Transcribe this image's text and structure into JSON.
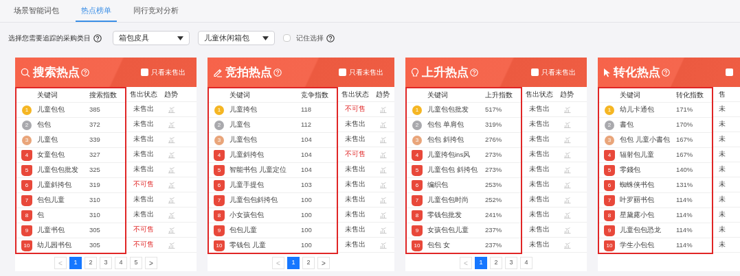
{
  "tabs": [
    {
      "label": "场景智能词包",
      "selected": false
    },
    {
      "label": "热点榜单",
      "selected": true
    },
    {
      "label": "同行竞对分析",
      "selected": false
    }
  ],
  "filter": {
    "label": "选择您需要追踪的采购类目",
    "category": "箱包皮具",
    "subcategory": "儿童休闲箱包",
    "remember": {
      "label": "记住选择",
      "checked": false
    }
  },
  "panels": [
    {
      "title": "搜索热点",
      "filter_checkbox": {
        "label": "只看未售出",
        "checked": false
      },
      "columns": [
        "关键词",
        "搜索指数",
        "售出状态",
        "趋势"
      ],
      "rows": [
        {
          "rank": "1",
          "keyword": "儿童包包",
          "index": "385",
          "status": "未售出",
          "kind": "unsold"
        },
        {
          "rank": "2",
          "keyword": "包包",
          "index": "372",
          "status": "未售出",
          "kind": "unsold"
        },
        {
          "rank": "3",
          "keyword": "儿童包",
          "index": "339",
          "status": "未售出",
          "kind": "unsold"
        },
        {
          "rank": "4",
          "keyword": "女童包包",
          "index": "327",
          "status": "未售出",
          "kind": "unsold"
        },
        {
          "rank": "5",
          "keyword": "儿童包包批发",
          "index": "325",
          "status": "未售出",
          "kind": "unsold"
        },
        {
          "rank": "6",
          "keyword": "儿童斜挎包",
          "index": "319",
          "status": "不可售",
          "kind": "unavailable"
        },
        {
          "rank": "7",
          "keyword": "包包儿童",
          "index": "310",
          "status": "未售出",
          "kind": "unsold"
        },
        {
          "rank": "8",
          "keyword": "包",
          "index": "310",
          "status": "未售出",
          "kind": "unsold"
        },
        {
          "rank": "9",
          "keyword": "儿童书包",
          "index": "305",
          "status": "不可售",
          "kind": "unavailable"
        },
        {
          "rank": "10",
          "keyword": "幼儿园书包",
          "index": "305",
          "status": "不可售",
          "kind": "unavailable"
        }
      ],
      "pagination": {
        "prev": "<",
        "next": ">",
        "pages": [
          {
            "label": "1",
            "selected": true
          },
          {
            "label": "2",
            "selected": false
          },
          {
            "label": "3",
            "selected": false
          },
          {
            "label": "4",
            "selected": false
          },
          {
            "label": "5",
            "selected": false
          }
        ]
      }
    },
    {
      "title": "竞拍热点",
      "filter_checkbox": {
        "label": "只看未售出",
        "checked": false
      },
      "columns": [
        "关键词",
        "竞争指数",
        "售出状态",
        "趋势"
      ],
      "rows": [
        {
          "rank": "1",
          "keyword": "儿童挎包",
          "index": "118",
          "status": "不可售",
          "kind": "unavailable"
        },
        {
          "rank": "2",
          "keyword": "儿童包",
          "index": "112",
          "status": "未售出",
          "kind": "unsold"
        },
        {
          "rank": "3",
          "keyword": "儿童包包",
          "index": "104",
          "status": "未售出",
          "kind": "unsold"
        },
        {
          "rank": "4",
          "keyword": "儿童斜挎包",
          "index": "104",
          "status": "不可售",
          "kind": "unavailable"
        },
        {
          "rank": "5",
          "keyword": "智能书包 儿童定位",
          "index": "104",
          "status": "未售出",
          "kind": "unsold"
        },
        {
          "rank": "6",
          "keyword": "儿童手提包",
          "index": "103",
          "status": "未售出",
          "kind": "unsold"
        },
        {
          "rank": "7",
          "keyword": "儿童包包斜挎包",
          "index": "100",
          "status": "未售出",
          "kind": "unsold"
        },
        {
          "rank": "8",
          "keyword": "小女孩包包",
          "index": "100",
          "status": "未售出",
          "kind": "unsold"
        },
        {
          "rank": "9",
          "keyword": "包包儿童",
          "index": "100",
          "status": "未售出",
          "kind": "unsold"
        },
        {
          "rank": "10",
          "keyword": "零钱包 儿童",
          "index": "100",
          "status": "未售出",
          "kind": "unsold"
        }
      ],
      "pagination": {
        "prev": "<",
        "next": ">",
        "pages": [
          {
            "label": "1",
            "selected": true
          },
          {
            "label": "2",
            "selected": false
          }
        ]
      }
    },
    {
      "title": "上升热点",
      "filter_checkbox": {
        "label": "只看未售出",
        "checked": false
      },
      "columns": [
        "关键词",
        "上升指数",
        "售出状态",
        "趋势"
      ],
      "rows": [
        {
          "rank": "1",
          "keyword": "儿童包包批发",
          "index": "517%",
          "status": "未售出",
          "kind": "unsold"
        },
        {
          "rank": "2",
          "keyword": "包包 单肩包",
          "index": "319%",
          "status": "未售出",
          "kind": "unsold"
        },
        {
          "rank": "3",
          "keyword": "包包 斜挎包",
          "index": "276%",
          "status": "未售出",
          "kind": "unsold"
        },
        {
          "rank": "4",
          "keyword": "儿童挎包ins风",
          "index": "273%",
          "status": "未售出",
          "kind": "unsold"
        },
        {
          "rank": "5",
          "keyword": "儿童包包 斜挎包",
          "index": "273%",
          "status": "未售出",
          "kind": "unsold"
        },
        {
          "rank": "6",
          "keyword": "编织包",
          "index": "253%",
          "status": "未售出",
          "kind": "unsold"
        },
        {
          "rank": "7",
          "keyword": "儿童包包时尚",
          "index": "252%",
          "status": "未售出",
          "kind": "unsold"
        },
        {
          "rank": "8",
          "keyword": "零钱包批发",
          "index": "241%",
          "status": "未售出",
          "kind": "unsold"
        },
        {
          "rank": "9",
          "keyword": "女孩包包儿童",
          "index": "237%",
          "status": "未售出",
          "kind": "unsold"
        },
        {
          "rank": "10",
          "keyword": "包包 女",
          "index": "237%",
          "status": "未售出",
          "kind": "unsold"
        }
      ],
      "pagination": {
        "prev": "<",
        "pages": [
          {
            "label": "1",
            "selected": true
          },
          {
            "label": "2",
            "selected": false
          },
          {
            "label": "3",
            "selected": false
          },
          {
            "label": "4",
            "selected": false
          }
        ]
      }
    },
    {
      "title": "转化热点",
      "filter_checkbox": {
        "checked": false
      },
      "columns": [
        "关键词",
        "转化指数",
        "售"
      ],
      "rows": [
        {
          "rank": "1",
          "keyword": "幼儿卡通包",
          "index": "171%",
          "status": "未",
          "kind": "unsold"
        },
        {
          "rank": "2",
          "keyword": "書包",
          "index": "170%",
          "status": "未",
          "kind": "unsold"
        },
        {
          "rank": "3",
          "keyword": "包包 儿童小書包",
          "index": "167%",
          "status": "未",
          "kind": "unsold"
        },
        {
          "rank": "4",
          "keyword": "辐射包儿童",
          "index": "167%",
          "status": "未",
          "kind": "unsold"
        },
        {
          "rank": "5",
          "keyword": "零錢包",
          "index": "140%",
          "status": "未",
          "kind": "unsold"
        },
        {
          "rank": "6",
          "keyword": "蜘蛛侠书包",
          "index": "131%",
          "status": "未",
          "kind": "unsold"
        },
        {
          "rank": "7",
          "keyword": "叶罗丽书包",
          "index": "114%",
          "status": "未",
          "kind": "unsold"
        },
        {
          "rank": "8",
          "keyword": "星黛露小包",
          "index": "114%",
          "status": "未",
          "kind": "unsold"
        },
        {
          "rank": "9",
          "keyword": "儿童包包恐龙",
          "index": "114%",
          "status": "未",
          "kind": "unsold"
        },
        {
          "rank": "10",
          "keyword": "学生小包包",
          "index": "114%",
          "status": "未",
          "kind": "unsold"
        }
      ]
    }
  ]
}
